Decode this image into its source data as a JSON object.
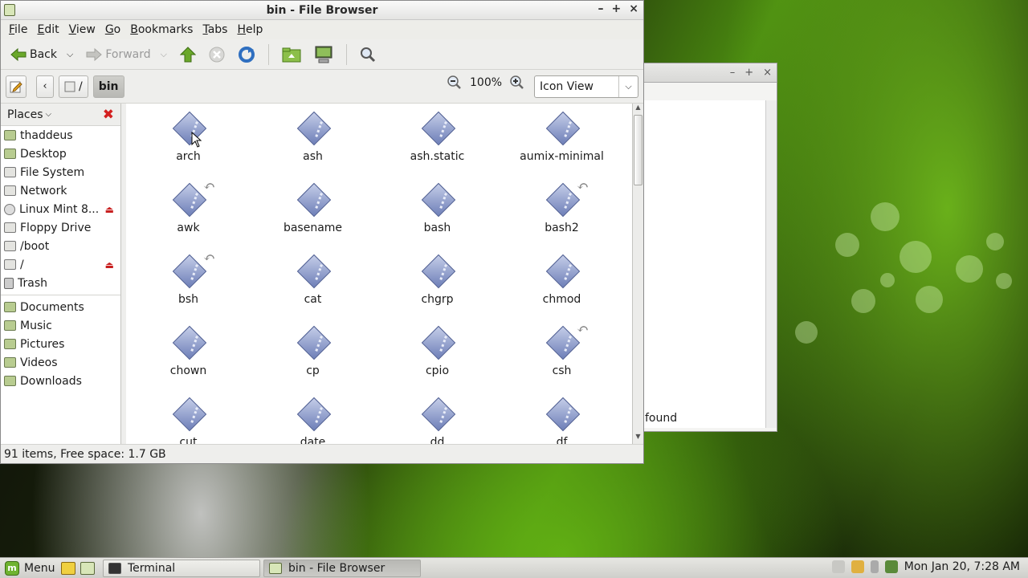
{
  "bg_window": {
    "controls": [
      "–",
      "+",
      "×"
    ],
    "visible_text": "found"
  },
  "window": {
    "title": "bin - File Browser",
    "controls": [
      "–",
      "+",
      "×"
    ],
    "menu": [
      "File",
      "Edit",
      "View",
      "Go",
      "Bookmarks",
      "Tabs",
      "Help"
    ],
    "toolbar": {
      "back_label": "Back",
      "forward_label": "Forward"
    },
    "location": {
      "crumbs": [
        "/",
        "bin"
      ],
      "zoom": "100%",
      "view_mode": "Icon View"
    },
    "places": {
      "header": "Places",
      "items": [
        {
          "label": "thaddeus",
          "icon": "home-folder-icon"
        },
        {
          "label": "Desktop",
          "icon": "desktop-folder-icon"
        },
        {
          "label": "File System",
          "icon": "drive-icon"
        },
        {
          "label": "Network",
          "icon": "network-icon"
        },
        {
          "label": "Linux Mint 8...",
          "icon": "disc-icon",
          "eject": true
        },
        {
          "label": "Floppy Drive",
          "icon": "floppy-icon"
        },
        {
          "label": "/boot",
          "icon": "drive-icon"
        },
        {
          "label": "/",
          "icon": "drive-icon",
          "eject": true
        },
        {
          "label": "Trash",
          "icon": "trash-icon"
        }
      ],
      "bookmarks": [
        {
          "label": "Documents",
          "icon": "folder-icon"
        },
        {
          "label": "Music",
          "icon": "folder-icon"
        },
        {
          "label": "Pictures",
          "icon": "folder-icon"
        },
        {
          "label": "Videos",
          "icon": "folder-icon"
        },
        {
          "label": "Downloads",
          "icon": "folder-icon"
        }
      ]
    },
    "files": [
      {
        "name": "arch",
        "link": false
      },
      {
        "name": "ash",
        "link": false
      },
      {
        "name": "ash.static",
        "link": false
      },
      {
        "name": "aumix-minimal",
        "link": false
      },
      {
        "name": "awk",
        "link": true
      },
      {
        "name": "basename",
        "link": false
      },
      {
        "name": "bash",
        "link": false
      },
      {
        "name": "bash2",
        "link": true
      },
      {
        "name": "bsh",
        "link": true
      },
      {
        "name": "cat",
        "link": false
      },
      {
        "name": "chgrp",
        "link": false
      },
      {
        "name": "chmod",
        "link": false
      },
      {
        "name": "chown",
        "link": false
      },
      {
        "name": "cp",
        "link": false
      },
      {
        "name": "cpio",
        "link": false
      },
      {
        "name": "csh",
        "link": true
      },
      {
        "name": "cut",
        "link": false
      },
      {
        "name": "date",
        "link": false
      },
      {
        "name": "dd",
        "link": false
      },
      {
        "name": "df",
        "link": false
      }
    ],
    "status": "91 items, Free space: 1.7 GB"
  },
  "panel": {
    "menu_label": "Menu",
    "tasks": [
      {
        "label": "Terminal",
        "active": false
      },
      {
        "label": "bin - File Browser",
        "active": true
      }
    ],
    "clock": "Mon Jan 20,  7:28 AM"
  },
  "colors": {
    "eject": "#c82020",
    "close_sidebar": "#d32020",
    "accent_green": "#6fb330"
  }
}
